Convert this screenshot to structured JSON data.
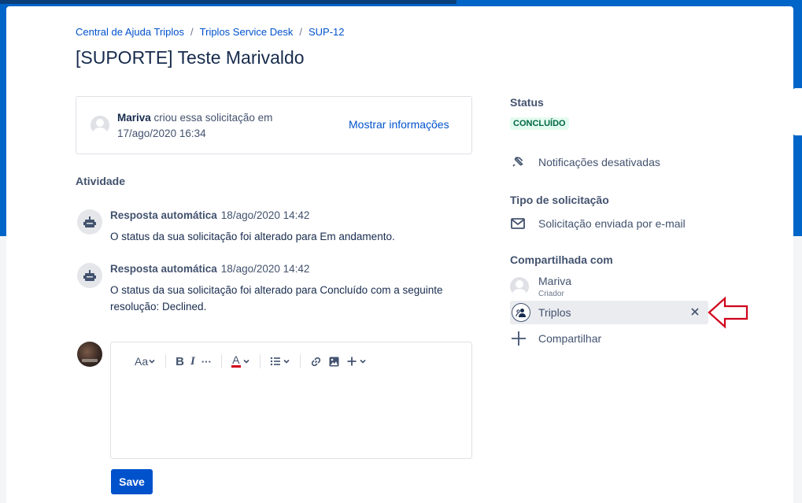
{
  "breadcrumb": {
    "items": [
      "Central de Ajuda Triplos",
      "Triplos Service Desk",
      "SUP-12"
    ],
    "separator": "/"
  },
  "page": {
    "title": "[SUPORTE] Teste Marivaldo"
  },
  "request": {
    "author": "Mariva",
    "created_text": " criou essa solicitação em 17/ago/2020 16:34",
    "show_info_label": "Mostrar informações"
  },
  "activity": {
    "heading": "Atividade",
    "items": [
      {
        "author": "Resposta automática",
        "timestamp": "18/ago/2020 14:42",
        "text": "O status da sua solicitação foi alterado para Em andamento."
      },
      {
        "author": "Resposta automática",
        "timestamp": "18/ago/2020 14:42",
        "text": "O status da sua solicitação foi alterado para Concluído com a seguinte resolução: Declined."
      }
    ]
  },
  "editor": {
    "toolbar": {
      "text_style_label": "Aa",
      "bold_label": "B",
      "italic_label": "I",
      "more_label": "···",
      "text_color_label": "A"
    },
    "save_label": "Save"
  },
  "sidebar": {
    "status_label": "Status",
    "status_value": "CONCLUÍDO",
    "notifications_label": "Notificações desativadas",
    "request_type_label": "Tipo de solicitação",
    "request_type_value": "Solicitação enviada por e-mail",
    "shared_label": "Compartilhada com",
    "shared": [
      {
        "name": "Mariva",
        "role": "Criador"
      },
      {
        "name": "Triplos"
      }
    ],
    "share_label": "Compartilhar"
  },
  "colors": {
    "brand_blue": "#0065c9",
    "link": "#0052cc",
    "status_bg": "#e3fcef",
    "status_text": "#006644",
    "annotation_arrow": "#d0021b"
  }
}
